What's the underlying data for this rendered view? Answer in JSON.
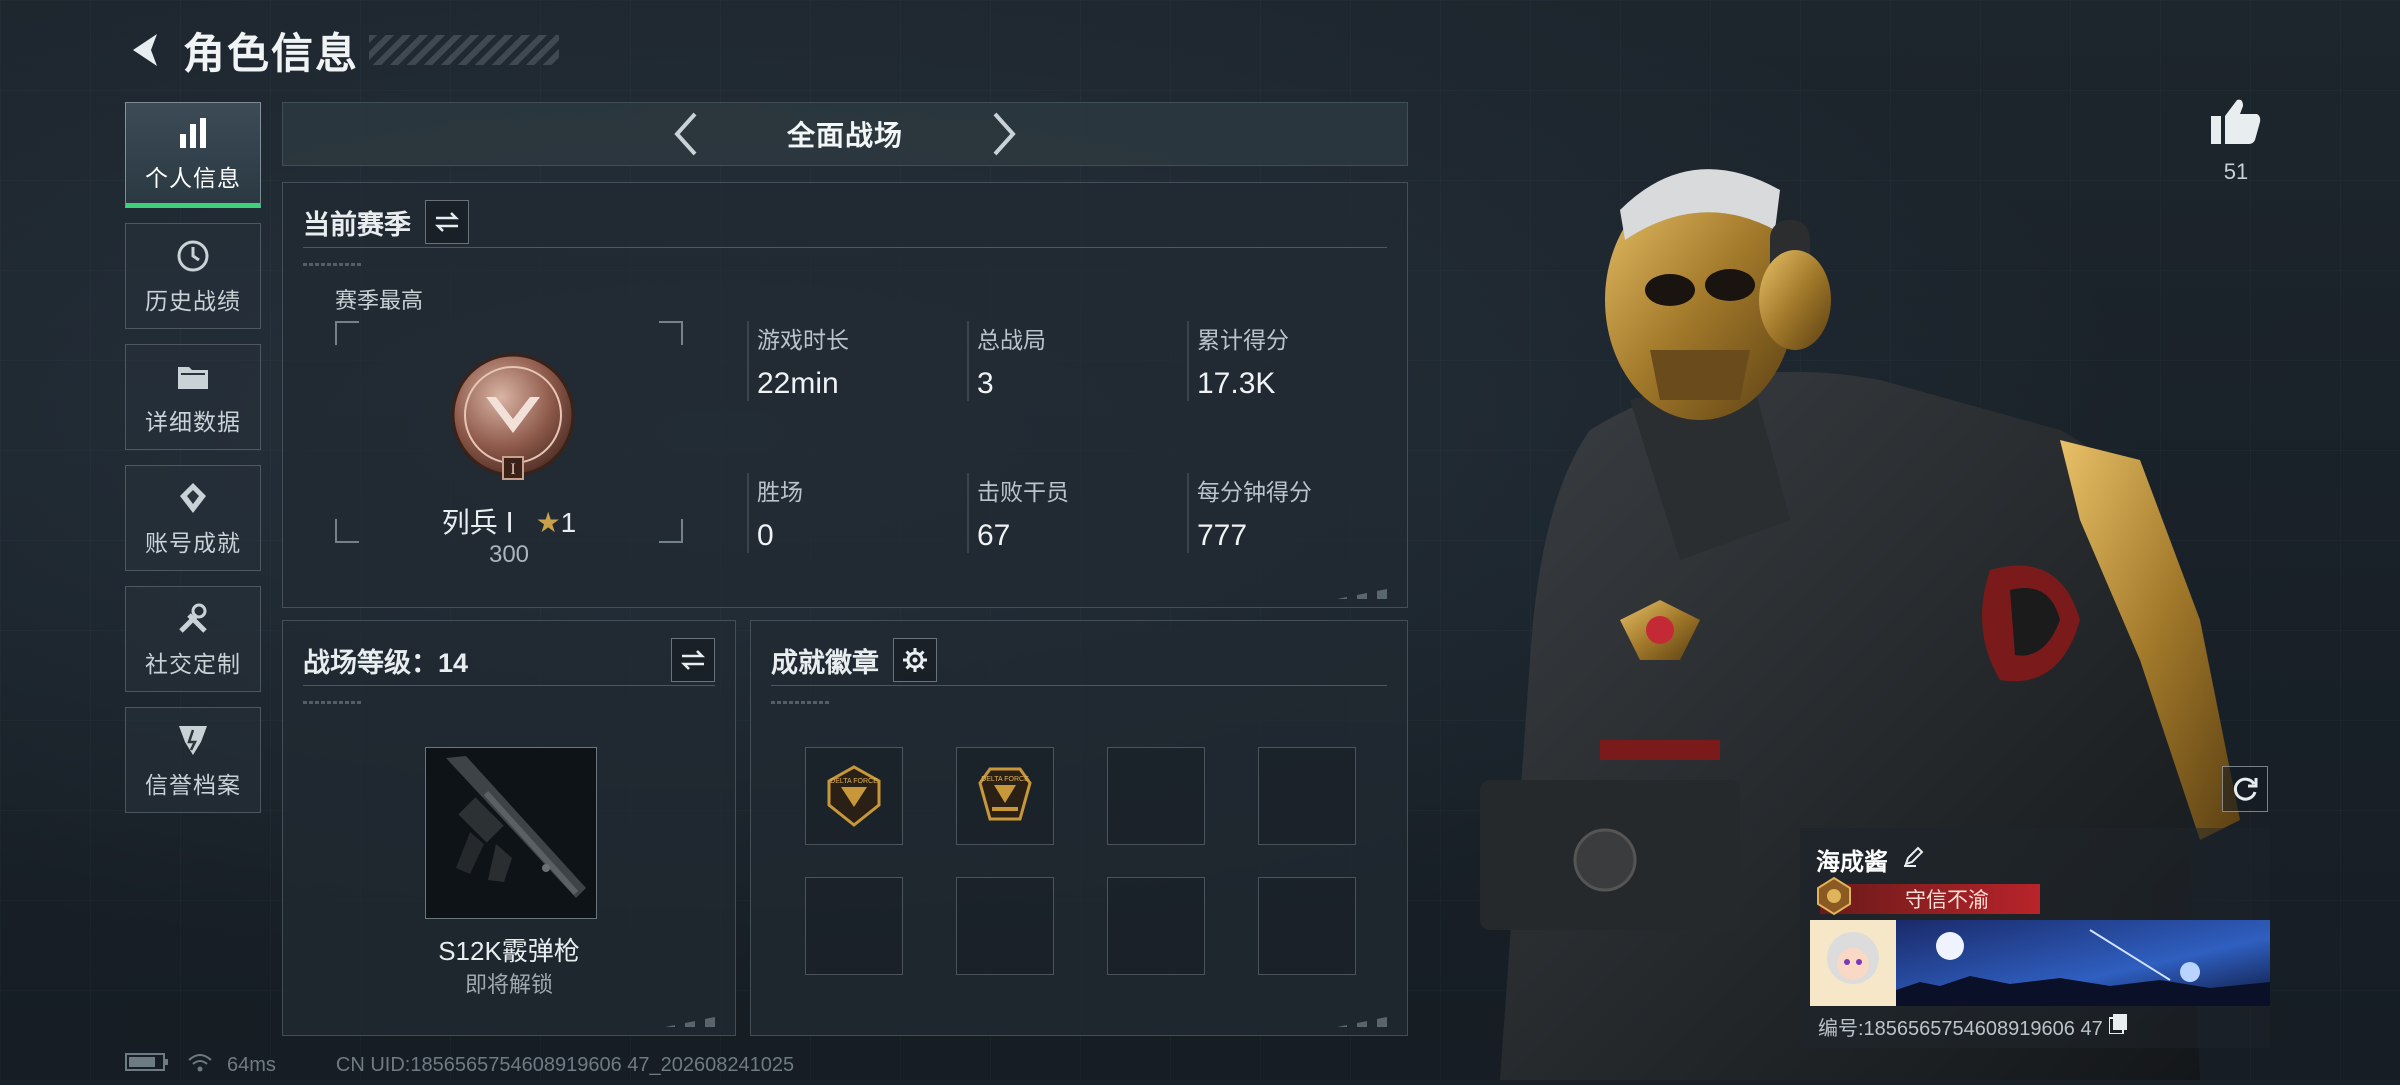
{
  "header": {
    "title": "角色信息"
  },
  "sidebar": {
    "items": [
      {
        "label": "个人信息",
        "icon": "bar-chart-icon",
        "active": true
      },
      {
        "label": "历史战绩",
        "icon": "history-icon",
        "active": false
      },
      {
        "label": "详细数据",
        "icon": "folder-icon",
        "active": false
      },
      {
        "label": "账号成就",
        "icon": "achievement-icon",
        "active": false
      },
      {
        "label": "社交定制",
        "icon": "tools-icon",
        "active": false
      },
      {
        "label": "信誉档案",
        "icon": "shield-icon",
        "active": false
      }
    ]
  },
  "mode": {
    "title": "全面战场"
  },
  "season": {
    "title": "当前赛季",
    "best_label": "赛季最高",
    "rank_name": "列兵 Ⅰ",
    "rank_stars": "1",
    "rank_points": "300",
    "rank_numeral": "I",
    "stats": [
      {
        "label": "游戏时长",
        "value": "22min"
      },
      {
        "label": "总战局",
        "value": "3"
      },
      {
        "label": "累计得分",
        "value": "17.3K"
      },
      {
        "label": "胜场",
        "value": "0"
      },
      {
        "label": "击败干员",
        "value": "67"
      },
      {
        "label": "每分钟得分",
        "value": "777"
      }
    ]
  },
  "battlefield": {
    "title": "战场等级：14",
    "weapon_name": "S12K霰弹枪",
    "weapon_status": "即将解锁"
  },
  "badges": {
    "title": "成就徽章",
    "slots": [
      {
        "filled": true,
        "text": "DELTA FORCE"
      },
      {
        "filled": true,
        "text": "DELTA FORCE"
      },
      {
        "filled": false
      },
      {
        "filled": false
      },
      {
        "filled": false
      },
      {
        "filled": false
      },
      {
        "filled": false
      },
      {
        "filled": false
      }
    ]
  },
  "profile": {
    "like_count": "51",
    "player_name": "海成酱",
    "player_title": "守信不渝",
    "uid_line": "编号:1856565754608919606 47"
  },
  "status": {
    "ping": "64ms",
    "uid": "CN UID:1856565754608919606 47_202608241025"
  },
  "colors": {
    "accent_green": "#3fd07b",
    "title_red": "#b8242a",
    "gold": "#c8973a"
  }
}
